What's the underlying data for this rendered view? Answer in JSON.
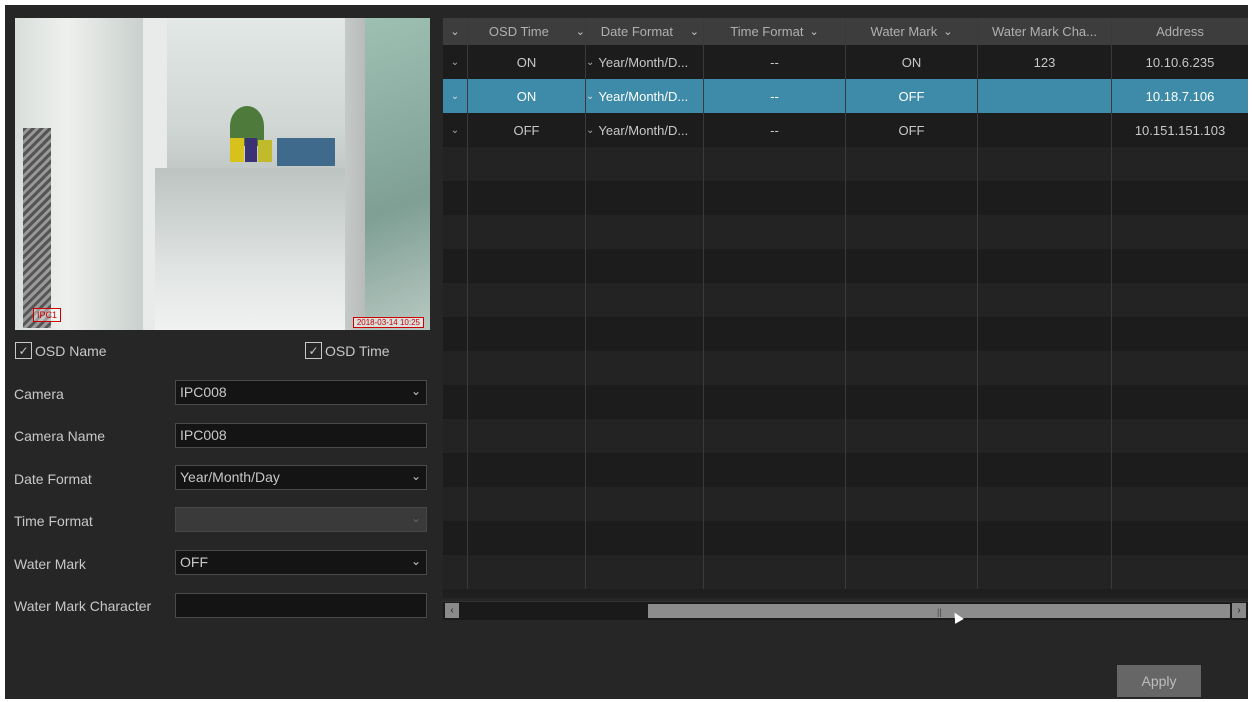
{
  "preview": {
    "osd_name_tag": "IPC1",
    "osd_time_tag": "2018-03-14 10:25"
  },
  "checkboxes": {
    "osd_name": {
      "label": "OSD Name",
      "checked": true
    },
    "osd_time": {
      "label": "OSD Time",
      "checked": true
    }
  },
  "form": {
    "camera": {
      "label": "Camera",
      "value": "IPC008"
    },
    "camera_name": {
      "label": "Camera Name",
      "value": "IPC008"
    },
    "date_format": {
      "label": "Date Format",
      "value": "Year/Month/Day"
    },
    "time_format": {
      "label": "Time Format",
      "value": ""
    },
    "water_mark": {
      "label": "Water Mark",
      "value": "OFF"
    },
    "water_mark_character": {
      "label": "Water Mark Character",
      "value": ""
    }
  },
  "table": {
    "headers": {
      "osd_time": "OSD Time",
      "date_format": "Date Format",
      "time_format": "Time Format",
      "water_mark": "Water Mark",
      "water_mark_char": "Water Mark Cha...",
      "address": "Address"
    },
    "rows": [
      {
        "osd_time": "ON",
        "date_format": "Year/Month/D...",
        "time_format": "--",
        "water_mark": "ON",
        "water_mark_char": "123",
        "address": "10.10.6.235"
      },
      {
        "osd_time": "ON",
        "date_format": "Year/Month/D...",
        "time_format": "--",
        "water_mark": "OFF",
        "water_mark_char": "",
        "address": "10.18.7.106"
      },
      {
        "osd_time": "OFF",
        "date_format": "Year/Month/D...",
        "time_format": "--",
        "water_mark": "OFF",
        "water_mark_char": "",
        "address": "10.151.151.103"
      }
    ],
    "selected_row_index": 1
  },
  "buttons": {
    "apply": "Apply"
  },
  "icons": {
    "dropdown": "chevron-down-icon",
    "check": "checkmark-icon",
    "scroll_left": "arrow-left-icon",
    "scroll_right": "arrow-right-icon"
  },
  "colors": {
    "background": "#262626",
    "selected_row": "#3d8ba8",
    "header": "#3d3d3d",
    "apply_button": "#666666"
  }
}
